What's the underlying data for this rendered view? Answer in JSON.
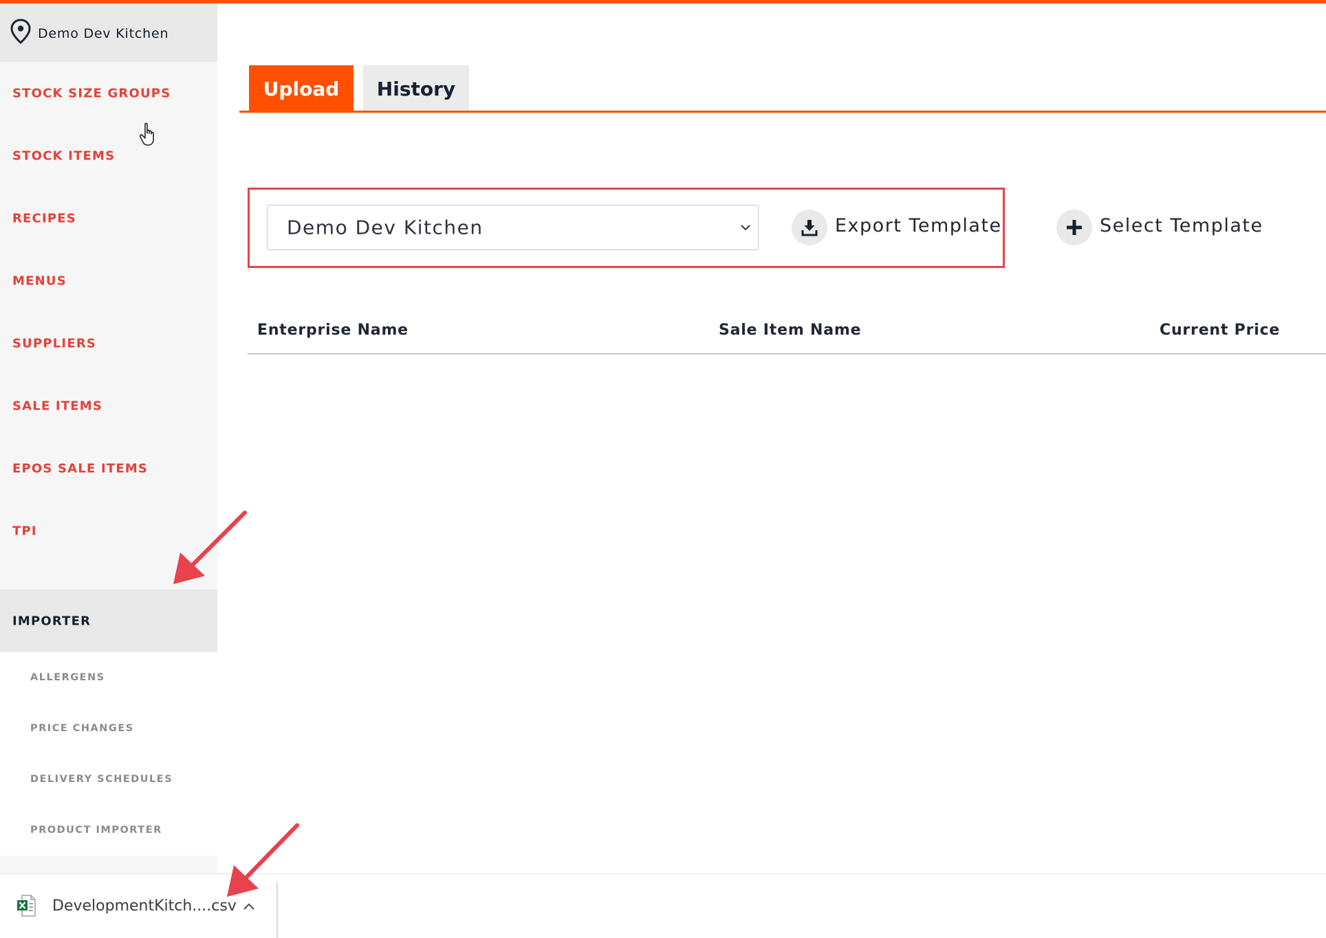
{
  "location": {
    "name": "Demo Dev Kitchen",
    "icon": "map-pin-icon"
  },
  "sidebar": {
    "items": [
      {
        "label": "STOCK SIZE GROUPS"
      },
      {
        "label": "STOCK ITEMS"
      },
      {
        "label": "RECIPES"
      },
      {
        "label": "MENUS"
      },
      {
        "label": "SUPPLIERS"
      },
      {
        "label": "SALE ITEMS"
      },
      {
        "label": "EPOS SALE ITEMS"
      },
      {
        "label": "TPI"
      },
      {
        "label": "IMPORTER"
      }
    ],
    "active_item": "IMPORTER",
    "sub_items": [
      {
        "label": "ALLERGENS"
      },
      {
        "label": "PRICE CHANGES"
      },
      {
        "label": "DELIVERY SCHEDULES"
      },
      {
        "label": "PRODUCT IMPORTER"
      }
    ]
  },
  "tabs": [
    {
      "label": "Upload",
      "active": true
    },
    {
      "label": "History",
      "active": false
    }
  ],
  "toolbar": {
    "select_value": "Demo Dev Kitchen",
    "export_label": "Export Template",
    "select_template_label": "Select Template",
    "export_icon": "download-icon",
    "select_template_icon": "plus-icon"
  },
  "table": {
    "columns": [
      "Enterprise Name",
      "Sale Item Name",
      "Current Price"
    ],
    "rows": []
  },
  "download_bar": {
    "file_name": "DevelopmentKitch....csv",
    "file_icon": "excel-file-icon"
  },
  "colors": {
    "accent": "#fe5000",
    "nav_text": "#e64037",
    "highlight": "#e8424c",
    "active_text": "#172033"
  }
}
